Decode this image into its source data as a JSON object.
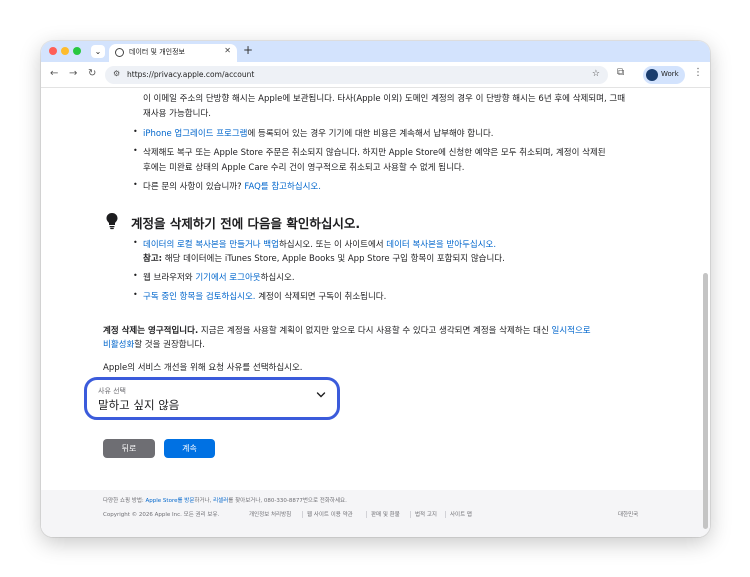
{
  "browser": {
    "tab_title": "데이터 및 개인정보",
    "new_tab": "+",
    "url": "https://privacy.apple.com/account",
    "profile_name": "Work"
  },
  "content": {
    "top_line1": "이 이메일 주소의 단방향 해시는 Apple에 보관됩니다. 타사(Apple 이외) 도메인 계정의 경우 이 단방향 해시는 6년 후에 삭제되며, 그때",
    "top_line2": "재사용 가능합니다.",
    "bullet1_link": "iPhone 업그레이드 프로그램",
    "bullet1_rest": "에 등록되어 있는 경우 기기에 대한 비용은 계속해서 납부해야 합니다.",
    "bullet2_line1": "삭제해도 복구 또는 Apple Store 주문은 취소되지 않습니다. 하지만 Apple Store에 신청한 예약은 모두 취소되며, 계정이 삭제된",
    "bullet2_line2": "후에는 미완료 상태의 Apple Care 수리 건이 영구적으로 취소되고 사용할 수 없게 됩니다.",
    "bullet3_text": "다른 문의 사항이 있습니까?",
    "bullet3_link": "FAQ를 참고하십시오.",
    "heading": "계정을 삭제하기 전에 다음을 확인하십시오.",
    "check1_link1": "데이터의 로컬 복사본을 만들거나 백업",
    "check1_mid": "하십시오. 또는 이 사이트에서",
    "check1_link2": "데이터 복사본을 받아두십시오.",
    "check1_note_bold": "참고:",
    "check1_note": "해당 데이터에는 iTunes Store, Apple Books 및 App Store 구입 항목이 포함되지 않습니다.",
    "check2_pre": "웹 브라우저와",
    "check2_link": "기기에서 로그아웃",
    "check2_post": "하십시오.",
    "check3_link": "구독 중인 항목을 검토하십시오.",
    "check3_rest": "계정이 삭제되면 구독이 취소됩니다.",
    "warn_bold": "계정 삭제는 영구적입니다.",
    "warn_text": "지금은 계정을 사용할 계획이 없지만 앞으로 다시 사용할 수 있다고 생각되면 계정을 삭제하는 대신",
    "warn_link1": "일시적으로",
    "warn_link2": "비활성화",
    "warn_end": "할 것을 권장합니다.",
    "reason_prompt": "Apple의 서비스 개선을 위해 요청 사유를 선택하십시오.",
    "select_label": "사유 선택",
    "select_value": "말하고 싶지 않음",
    "back_button": "뒤로",
    "continue_button": "계속"
  },
  "footer": {
    "line1_pre": "다양한 쇼핑 방법:",
    "line1_link1": "Apple Store를 방문",
    "line1_mid": "하거나,",
    "line1_link2": "리셀러",
    "line1_post": "를 찾아보거나, 080-330-8877번으로 전화하세요.",
    "copyright": "Copyright © 2026 Apple Inc. 모든 권리 보유.",
    "links": [
      "개인정보 처리방침",
      "웹 사이트 이용 약관",
      "판매 및 환불",
      "법적 고지",
      "사이트 맵"
    ],
    "region": "대한민국"
  },
  "colors": {
    "link": "#0066cc",
    "primary_button": "#0071e3",
    "secondary_button": "#6e6e73",
    "focus_ring": "#3b5bdb",
    "tabbar": "#d3e3fd"
  }
}
